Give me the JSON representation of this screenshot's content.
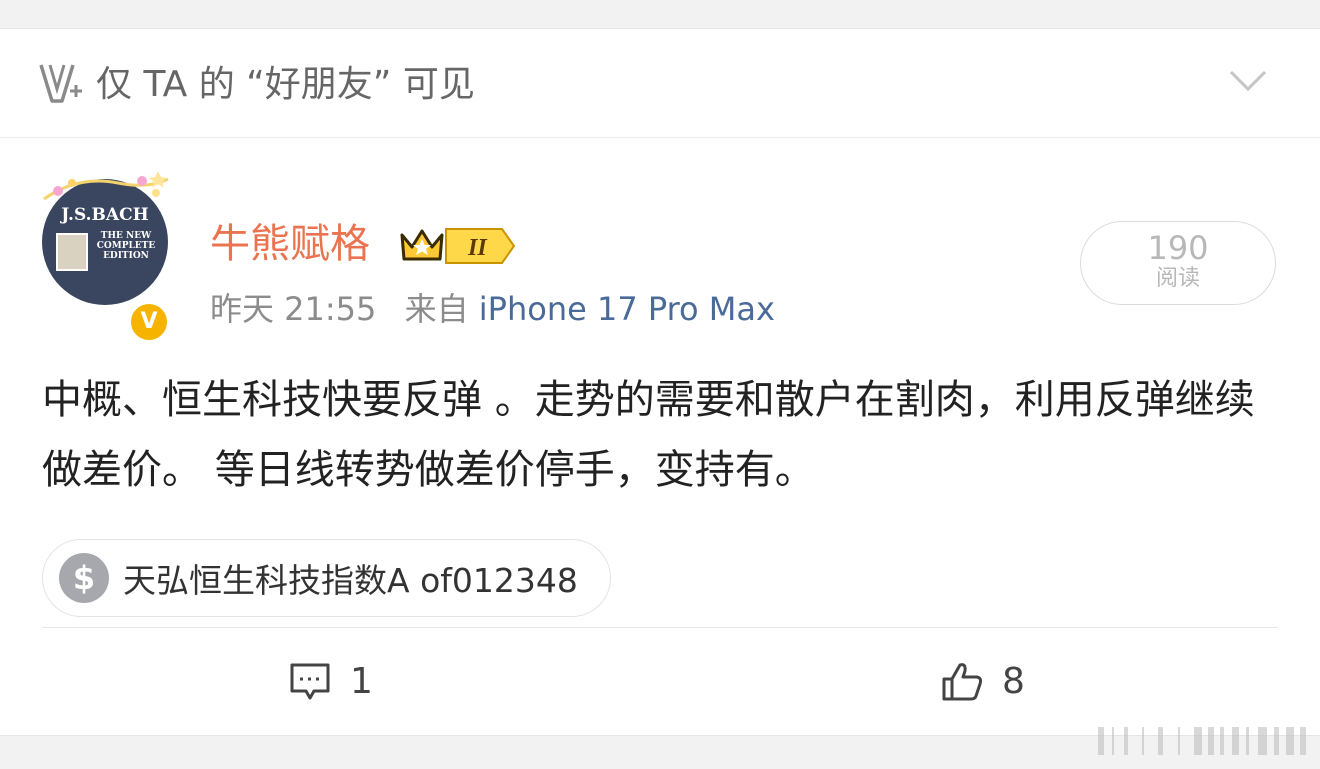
{
  "visibility": {
    "label": "仅 TA 的 “好朋友” 可见",
    "icon": "v-plus-icon"
  },
  "user": {
    "name": "牛熊赋格",
    "avatar_title": "J.S.BACH",
    "avatar_subtitle": "THE NEW COMPLETE EDITION",
    "verified_badge": "V",
    "level_badge": "II",
    "time": "昨天 21:55",
    "source_prefix": "来自",
    "device": "iPhone 17 Pro Max"
  },
  "reads": {
    "count": "190",
    "label": "阅读"
  },
  "post": {
    "text": "中概、恒生科技快要反弹 。走势的需要和散户在割肉，利用反弹继续做差价。 等日线转势做差价停手，变持有。"
  },
  "fund_tag": {
    "icon_glyph": "$",
    "label": "天弘恒生科技指数A of012348"
  },
  "actions": {
    "comment_count": "1",
    "like_count": "8"
  },
  "colors": {
    "username": "#eb7350",
    "device": "#4a6b9a",
    "badge": "#f6b400"
  }
}
